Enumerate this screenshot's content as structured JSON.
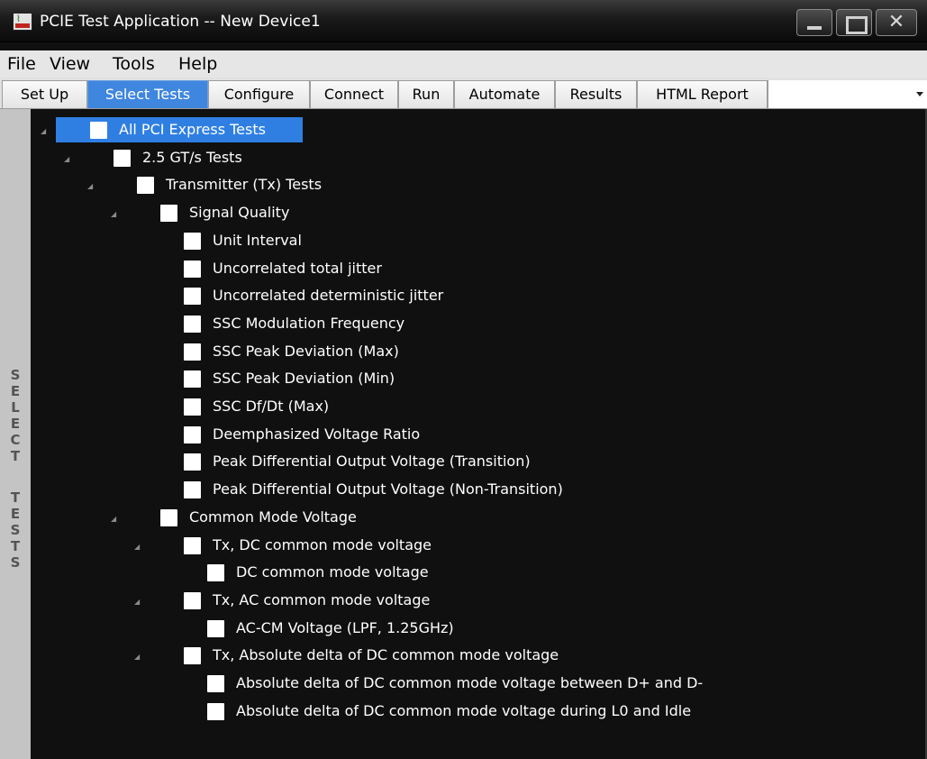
{
  "window": {
    "title": "PCIE Test Application -- New Device1",
    "icon": "oscilloscope-app-icon",
    "controls": [
      "minimize-icon",
      "maximize-icon",
      "close-icon"
    ]
  },
  "menu": [
    "File",
    "View",
    "Tools",
    "Help"
  ],
  "tabs": [
    {
      "label": "Set Up",
      "active": false
    },
    {
      "label": "Select Tests",
      "active": true
    },
    {
      "label": "Configure",
      "active": false
    },
    {
      "label": "Connect",
      "active": false
    },
    {
      "label": "Run",
      "active": false
    },
    {
      "label": "Automate",
      "active": false
    },
    {
      "label": "Results",
      "active": false
    },
    {
      "label": "HTML Report",
      "active": false
    }
  ],
  "side_label": "SELECT TESTS",
  "tree": [
    {
      "label": "All PCI Express Tests",
      "level": 0,
      "expandable": true,
      "selected": true,
      "checked": false
    },
    {
      "label": "2.5 GT/s Tests",
      "level": 1,
      "expandable": true,
      "selected": false,
      "checked": false
    },
    {
      "label": "Transmitter (Tx) Tests",
      "level": 2,
      "expandable": true,
      "selected": false,
      "checked": false
    },
    {
      "label": "Signal Quality",
      "level": 3,
      "expandable": true,
      "selected": false,
      "checked": false
    },
    {
      "label": "Unit Interval",
      "level": 4,
      "expandable": false,
      "selected": false,
      "checked": false
    },
    {
      "label": "Uncorrelated total jitter",
      "level": 4,
      "expandable": false,
      "selected": false,
      "checked": false
    },
    {
      "label": "Uncorrelated deterministic jitter",
      "level": 4,
      "expandable": false,
      "selected": false,
      "checked": false
    },
    {
      "label": "SSC Modulation Frequency",
      "level": 4,
      "expandable": false,
      "selected": false,
      "checked": false
    },
    {
      "label": "SSC Peak Deviation (Max)",
      "level": 4,
      "expandable": false,
      "selected": false,
      "checked": false
    },
    {
      "label": "SSC Peak Deviation (Min)",
      "level": 4,
      "expandable": false,
      "selected": false,
      "checked": false
    },
    {
      "label": "SSC Df/Dt (Max)",
      "level": 4,
      "expandable": false,
      "selected": false,
      "checked": false
    },
    {
      "label": "Deemphasized Voltage Ratio",
      "level": 4,
      "expandable": false,
      "selected": false,
      "checked": false
    },
    {
      "label": "Peak Differential Output Voltage (Transition)",
      "level": 4,
      "expandable": false,
      "selected": false,
      "checked": false
    },
    {
      "label": "Peak Differential Output Voltage (Non-Transition)",
      "level": 4,
      "expandable": false,
      "selected": false,
      "checked": false
    },
    {
      "label": "Common Mode Voltage",
      "level": 3,
      "expandable": true,
      "selected": false,
      "checked": false
    },
    {
      "label": "Tx, DC common mode voltage",
      "level": 4,
      "expandable": true,
      "selected": false,
      "checked": false
    },
    {
      "label": "DC common mode voltage",
      "level": 5,
      "expandable": false,
      "selected": false,
      "checked": false
    },
    {
      "label": "Tx, AC common mode voltage",
      "level": 4,
      "expandable": true,
      "selected": false,
      "checked": false
    },
    {
      "label": "AC-CM Voltage (LPF, 1.25GHz)",
      "level": 5,
      "expandable": false,
      "selected": false,
      "checked": false
    },
    {
      "label": "Tx, Absolute delta of DC common mode voltage",
      "level": 4,
      "expandable": true,
      "selected": false,
      "checked": false
    },
    {
      "label": "Absolute delta of DC common mode voltage between D+ and D-",
      "level": 5,
      "expandable": false,
      "selected": false,
      "checked": false
    },
    {
      "label": "Absolute delta of DC common mode voltage during L0 and Idle",
      "level": 5,
      "expandable": false,
      "selected": false,
      "checked": false
    }
  ],
  "colors": {
    "tree_background": "#101010",
    "selection": "#2f7fe3",
    "active_tab": "#3f86df",
    "side_strip": "#c4c4c4"
  }
}
